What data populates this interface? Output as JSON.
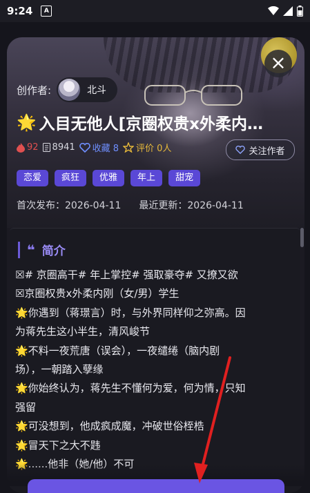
{
  "status_bar": {
    "time": "9:24",
    "app_icon": "A"
  },
  "creator": {
    "label": "创作者:",
    "name": "北斗"
  },
  "title": "入目无他人[京圈权贵x外柔内…",
  "stats": {
    "hot": "92",
    "reads": "8941",
    "favorites": "收藏 8",
    "rating": "评价 0人"
  },
  "follow_button": "关注作者",
  "tags": [
    "恋爱",
    "疯狂",
    "优雅",
    "年上",
    "甜宠"
  ],
  "dates": {
    "first_publish": "首次发布：2026-04-11",
    "last_update": "最近更新：2026-04-11"
  },
  "intro": {
    "title": "简介",
    "lines": [
      "☒# 京圈高干# 年上掌控# 强取豪夺# 又撩又欲",
      "☒京圈权贵x外柔内刚（女/男）学生",
      "🌟你遇到（蒋璟言）时，与外界同样仰之弥高。因",
      "为蒋先生这小半生，清风峻节",
      "🌟不料一夜荒唐（误会），一夜缱绻（脑内剧",
      "场），一朝踏入孽缘",
      "🌟你始终认为，蒋先生不懂何为爱，何为情，只知",
      "强留",
      "🌟可没想到，他成疯成魔，冲破世俗桎梏",
      "🌟冒天下之大不韪",
      "🌟......他非（她/他）不可"
    ]
  },
  "colors": {
    "accent": "#5a48d6",
    "background": "#15151c"
  }
}
